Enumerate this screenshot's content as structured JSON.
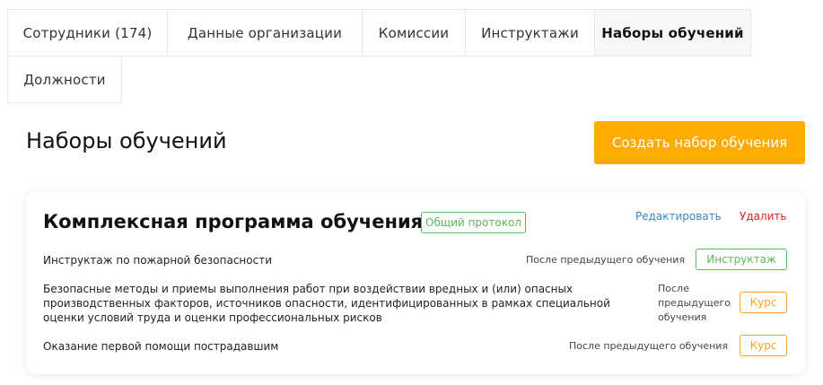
{
  "tabs": [
    {
      "label": "Сотрудники (174)",
      "active": false
    },
    {
      "label": "Данные организации",
      "active": false
    },
    {
      "label": "Комиссии",
      "active": false
    },
    {
      "label": "Инструктажи",
      "active": false
    },
    {
      "label": "Наборы обучений",
      "active": true
    },
    {
      "label": "Должности",
      "active": false
    }
  ],
  "page": {
    "title": "Наборы обучений",
    "create_button": "Создать набор обучения"
  },
  "card": {
    "title": "Комплексная программа обучения",
    "badge": "Общий протокол",
    "edit": "Редактировать",
    "delete": "Удалить",
    "rows": [
      {
        "name": "Инструктаж по пожарной безопасности",
        "when": "После предыдущего обучения",
        "type": "Инструктаж"
      },
      {
        "name": "Безопасные методы и приемы выполнения работ при воздействии вредных и (или) опасных производственных факторов, источников опасности, идентифицированных в рамках специальной оценки условий труда и оценки профессиональных рисков",
        "when": "После предыдущего обучения",
        "type": "Курс"
      },
      {
        "name": "Оказание первой помощи пострадавшим",
        "when": "После предыдущего обучения",
        "type": "Курс"
      }
    ]
  },
  "colors": {
    "accent": "#ffab00",
    "link": "#3a86c8",
    "danger": "#e02020",
    "green": "#5cb85c",
    "orange": "#f5a623"
  }
}
